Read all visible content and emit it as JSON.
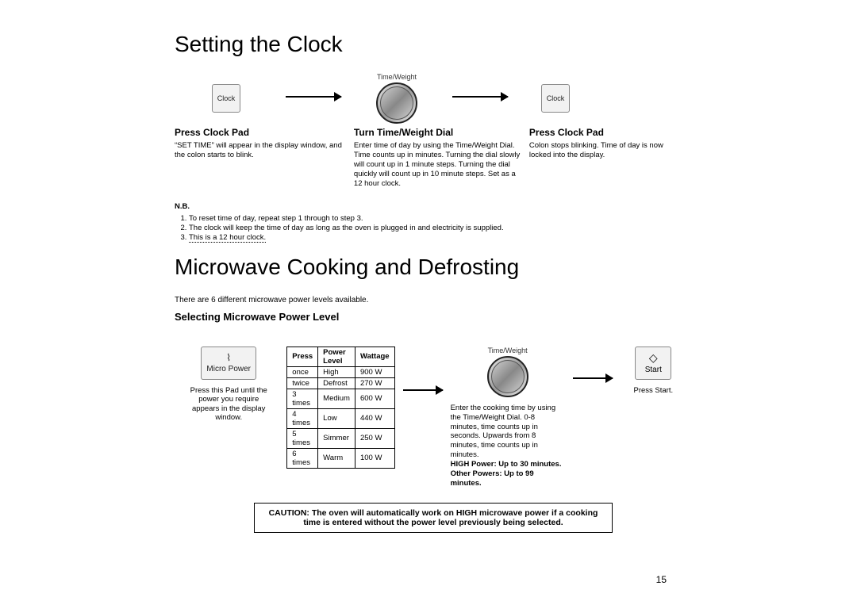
{
  "section1": {
    "title": "Setting the Clock",
    "steps": [
      {
        "pad_label": "Clock",
        "heading": "Press Clock Pad",
        "desc": "“SET TIME” will appear in the display window, and the colon starts to blink."
      },
      {
        "dial_label": "Time/Weight",
        "heading": "Turn Time/Weight Dial",
        "desc": "Enter time of day by using the Time/Weight Dial. Time counts up in minutes. Turning the dial slowly will count up in 1 minute steps. Turning the dial quickly will count up in 10 minute steps. Set as a 12 hour clock."
      },
      {
        "pad_label": "Clock",
        "heading": "Press Clock Pad",
        "desc": "Colon stops blinking. Time of day is now locked into the display."
      }
    ],
    "nb_title": "N.B.",
    "nb_items": [
      "To reset time of day, repeat step 1 through to step 3.",
      "The clock will keep the time of day as long as the oven is plugged in and electricity is supplied.",
      "This is a 12 hour clock."
    ]
  },
  "section2": {
    "title": "Microwave Cooking and Defrosting",
    "subtitle": "There are 6 different microwave power levels available.",
    "heading": "Selecting Microwave Power Level",
    "micro_pad_label": "Micro Power",
    "micro_desc": "Press this Pad until the power you require appears in the display window.",
    "table_headers": [
      "Press",
      "Power Level",
      "Wattage"
    ],
    "table_rows": [
      [
        "once",
        "High",
        "900 W"
      ],
      [
        "twice",
        "Defrost",
        "270 W"
      ],
      [
        "3 times",
        "Medium",
        "600 W"
      ],
      [
        "4 times",
        "Low",
        "440 W"
      ],
      [
        "5 times",
        "Simmer",
        "250 W"
      ],
      [
        "6 times",
        "Warm",
        "100 W"
      ]
    ],
    "dial_label": "Time/Weight",
    "cook_desc": "Enter the cooking time by using the Time/Weight Dial. 0-8 minutes, time counts up in seconds. Upwards from 8 minutes, time counts up in minutes.",
    "cook_bold1": "HIGH Power: Up to 30 minutes.",
    "cook_bold2": "Other Powers: Up to 99 minutes.",
    "start_label": "Start",
    "start_desc": "Press Start.",
    "caution": "CAUTION: The oven will automatically work on HIGH microwave power if a cooking time is entered without the power level previously being selected."
  },
  "page_number": "15"
}
